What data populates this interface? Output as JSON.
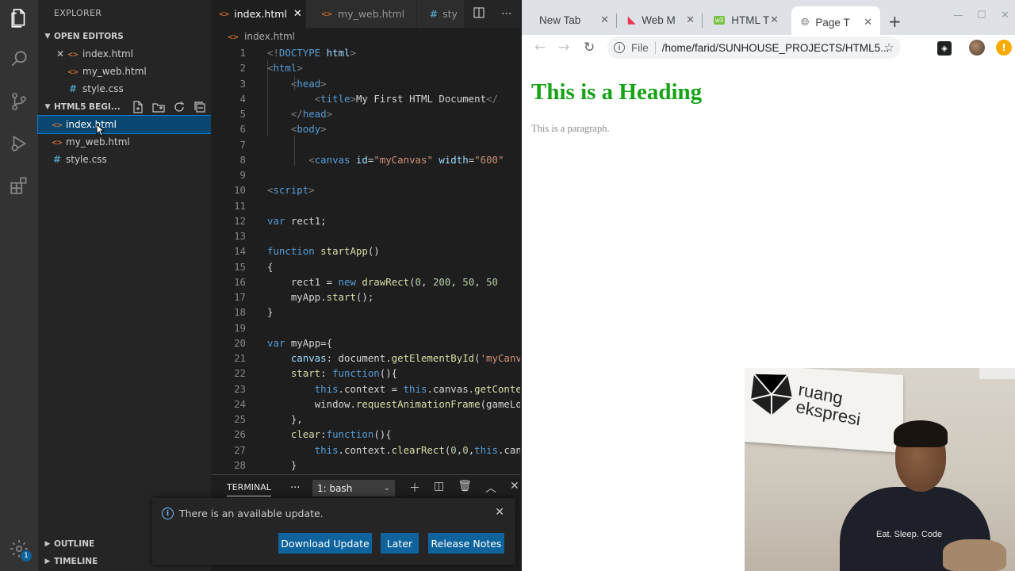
{
  "vscode": {
    "explorer_title": "EXPLORER",
    "open_editors_label": "OPEN EDITORS",
    "open_editors": [
      {
        "name": "index.html",
        "type": "html"
      },
      {
        "name": "my_web.html",
        "type": "html"
      },
      {
        "name": "style.css",
        "type": "css"
      }
    ],
    "project_label": "HTML5 BEGI...",
    "files": [
      {
        "name": "index.html",
        "type": "html"
      },
      {
        "name": "my_web.html",
        "type": "html"
      },
      {
        "name": "style.css",
        "type": "css"
      }
    ],
    "outline_label": "OUTLINE",
    "timeline_label": "TIMELINE",
    "tabs": [
      {
        "name": "index.html",
        "type": "html"
      },
      {
        "name": "my_web.html",
        "type": "html"
      },
      {
        "name": "sty",
        "type": "css"
      }
    ],
    "breadcrumb": "index.html",
    "code_lines": [
      {
        "n": "1",
        "html": "<span class='br'>&lt;!</span><span class='tg'>DOCTYPE</span> <span class='at'>html</span><span class='br'>&gt;</span>"
      },
      {
        "n": "2",
        "html": "<span class='br'>&lt;</span><span class='tg'>html</span><span class='br'>&gt;</span>"
      },
      {
        "n": "3",
        "html": "    <span class='br'>&lt;</span><span class='tg'>head</span><span class='br'>&gt;</span>"
      },
      {
        "n": "4",
        "html": "        <span class='br'>&lt;</span><span class='tg'>title</span><span class='br'>&gt;</span><span class='tx'>My First HTML Document</span><span class='br'>&lt;/</span>"
      },
      {
        "n": "5",
        "html": "    <span class='br'>&lt;/</span><span class='tg'>head</span><span class='br'>&gt;</span>"
      },
      {
        "n": "6",
        "html": "    <span class='br'>&lt;</span><span class='tg'>body</span><span class='br'>&gt;</span>"
      },
      {
        "n": "7",
        "html": ""
      },
      {
        "n": "8",
        "html": "       <span class='br'>&lt;</span><span class='tg'>canvas</span> <span class='at'>id</span><span class='tx'>=</span><span class='st'>\"myCanvas\"</span> <span class='at'>width</span><span class='tx'>=</span><span class='st'>\"600\"</span>"
      },
      {
        "n": "9",
        "html": ""
      },
      {
        "n": "10",
        "html": "<span class='br'>&lt;</span><span class='tg'>script</span><span class='br'>&gt;</span>"
      },
      {
        "n": "11",
        "html": ""
      },
      {
        "n": "12",
        "html": "<span class='kw'>var</span> <span class='tx'>rect1;</span>"
      },
      {
        "n": "13",
        "html": ""
      },
      {
        "n": "14",
        "html": "<span class='kw'>function</span> <span class='fn'>startApp</span><span class='tx'>()</span>"
      },
      {
        "n": "15",
        "html": "<span class='tx'>{</span>"
      },
      {
        "n": "16",
        "html": "    <span class='tx'>rect1 = </span><span class='kw'>new</span> <span class='fn'>drawRect</span><span class='tx'>(</span><span class='nm'>0</span><span class='tx'>, </span><span class='nm'>200</span><span class='tx'>, </span><span class='nm'>50</span><span class='tx'>, </span><span class='nm'>50</span>"
      },
      {
        "n": "17",
        "html": "    <span class='tx'>myApp.</span><span class='fn'>start</span><span class='tx'>();</span>"
      },
      {
        "n": "18",
        "html": "<span class='tx'>}</span>"
      },
      {
        "n": "19",
        "html": ""
      },
      {
        "n": "20",
        "html": "<span class='kw'>var</span> <span class='tx'>myApp={</span>"
      },
      {
        "n": "21",
        "html": "    <span class='pr'>canvas</span><span class='tx'>: document.</span><span class='fn'>getElementById</span><span class='tx'>(</span><span class='st'>'myCanvas'</span>"
      },
      {
        "n": "22",
        "html": "    <span class='fn'>start</span><span class='tx'>: </span><span class='kw'>function</span><span class='tx'>(){</span>"
      },
      {
        "n": "23",
        "html": "        <span class='kw'>this</span><span class='tx'>.context = </span><span class='kw'>this</span><span class='tx'>.canvas.</span><span class='fn'>getContext</span>"
      },
      {
        "n": "24",
        "html": "        <span class='tx'>window.</span><span class='fn'>requestAnimationFrame</span><span class='tx'>(gameLoop</span>"
      },
      {
        "n": "25",
        "html": "    <span class='tx'>},</span>"
      },
      {
        "n": "26",
        "html": "    <span class='fn'>clear</span><span class='tx'>:</span><span class='kw'>function</span><span class='tx'>(){</span>"
      },
      {
        "n": "27",
        "html": "        <span class='kw'>this</span><span class='tx'>.context.</span><span class='fn'>clearRect</span><span class='tx'>(</span><span class='nm'>0</span><span class='tx'>,</span><span class='nm'>0</span><span class='tx'>,</span><span class='kw'>this</span><span class='tx'>.canvas</span>"
      },
      {
        "n": "28",
        "html": "    <span class='tx'>}</span>"
      }
    ],
    "terminal_label": "TERMINAL",
    "terminal_more": "···",
    "terminal_select": "1: bash",
    "notification": {
      "message": "There is an available update.",
      "buttons": [
        "Download Update",
        "Later",
        "Release Notes"
      ]
    },
    "accounts_badge": "1"
  },
  "chrome": {
    "tabs": [
      {
        "title": "New Tab"
      },
      {
        "title": "Web M"
      },
      {
        "title": "HTML T"
      },
      {
        "title": "Page T"
      }
    ],
    "url_scheme": "File",
    "url": "/home/farid/SUNHOUSE_PROJECTS/HTML5...",
    "page": {
      "heading": "This is a Heading",
      "paragraph": "This is a paragraph.",
      "heading_color": "#16a316"
    }
  },
  "webcam": {
    "banner_line1": "ruang",
    "banner_line2": "ekspresi",
    "shirt_text": "Eat. Sleep. Code"
  }
}
